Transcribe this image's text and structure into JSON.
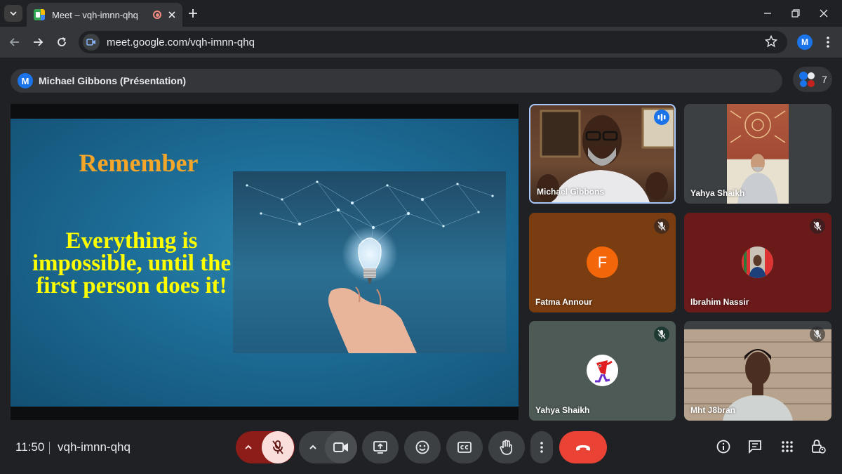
{
  "browser": {
    "tab_title": "Meet – vqh-imnn-qhq",
    "url": "meet.google.com/vqh-imnn-qhq",
    "profile_initial": "M"
  },
  "meet": {
    "presenter_initial": "M",
    "presenter_label": "Michael Gibbons (Présentation)",
    "participant_count": "7",
    "slide": {
      "title": "Remember",
      "quote": "Everything is impossible, until the first person does it!"
    },
    "tiles": [
      {
        "name": "Michael Gibbons"
      },
      {
        "name": "Yahya Shaikh"
      },
      {
        "name": "Fatma Annour",
        "initial": "F"
      },
      {
        "name": "Ibrahim Nassir"
      },
      {
        "name": "Yahya Shaikh"
      },
      {
        "name": "Mht J8bran"
      }
    ],
    "time": "11:50",
    "meeting_code": "vqh-imnn-qhq"
  },
  "colors": {
    "end_call": "#ea4335",
    "mic_off_bg": "#f9dedc",
    "mic_chevron_bg": "#8c1d18",
    "accent_blue": "#1a73e8"
  }
}
